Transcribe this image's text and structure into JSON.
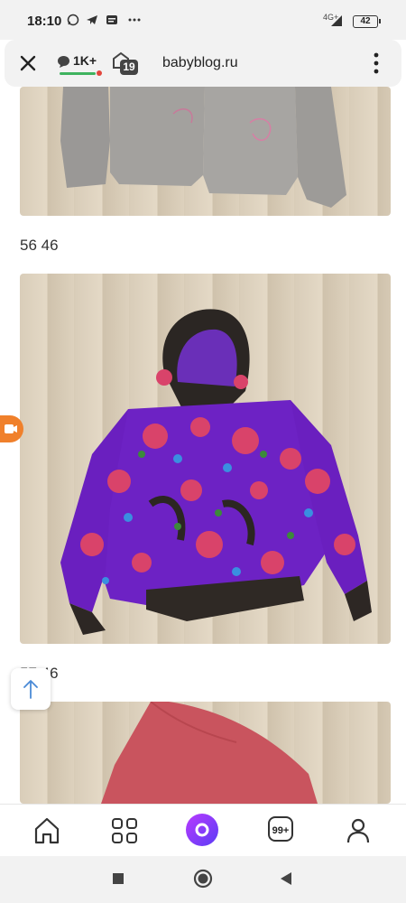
{
  "status_bar": {
    "time": "18:10",
    "network": "4G+",
    "battery": "42"
  },
  "browser": {
    "comments_count": "1K+",
    "tabs_count": "19",
    "url": "babyblog.ru"
  },
  "content": {
    "caption_1": "56 46",
    "caption_2": "57 46"
  },
  "colors": {
    "accent_green": "#3fb35f",
    "notification_red": "#e2463c",
    "record_orange": "#f0802b",
    "alice_purple": "#7b3cff"
  },
  "bottom_nav": {
    "tabs_badge": "99+"
  },
  "icons": [
    "whatsapp-icon",
    "telegram-icon",
    "message-icon",
    "more-icon",
    "close-icon",
    "comment-icon",
    "tabs-icon",
    "menu-icon",
    "record-icon",
    "arrow-up-icon",
    "home-icon",
    "apps-icon",
    "alice-icon",
    "profile-icon",
    "stop-icon",
    "home-circle-icon",
    "back-icon"
  ]
}
